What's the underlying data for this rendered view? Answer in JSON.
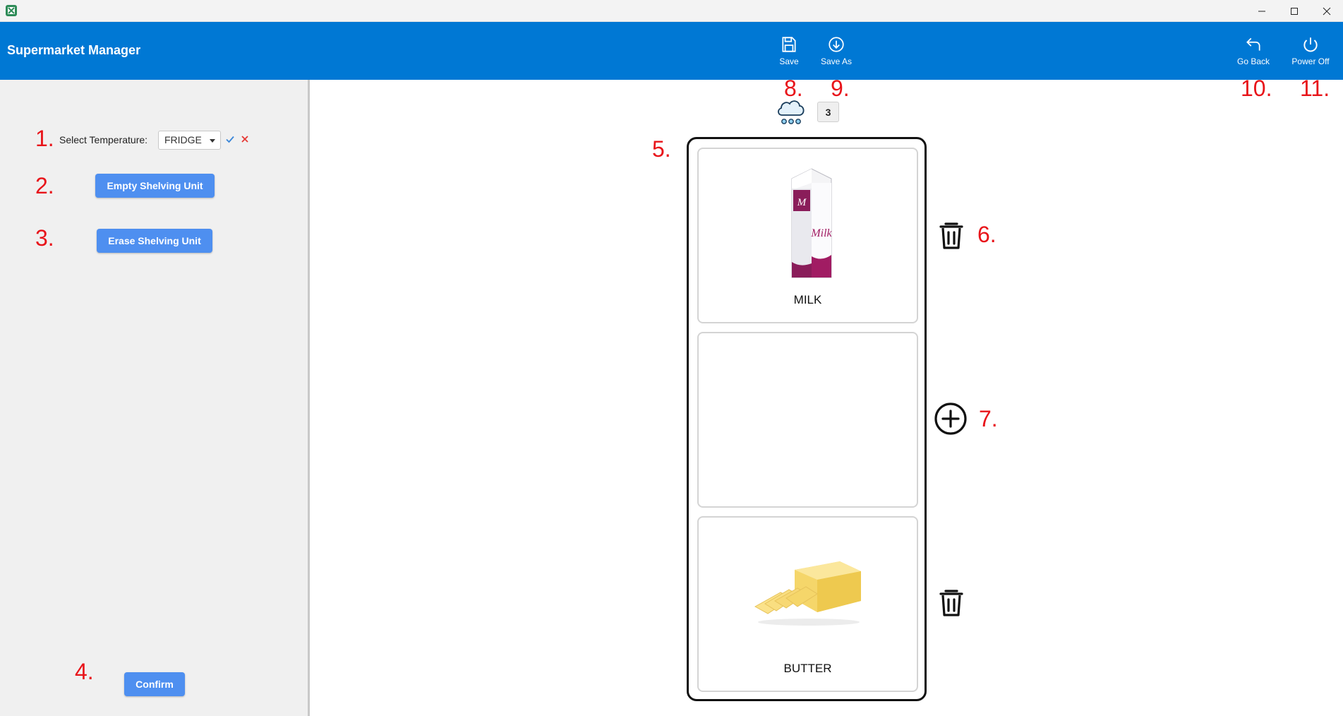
{
  "window": {
    "title": ""
  },
  "header": {
    "title": "Supermarket Manager",
    "save_label": "Save",
    "save_as_label": "Save As",
    "go_back_label": "Go Back",
    "power_off_label": "Power Off"
  },
  "left_panel": {
    "temperature_label": "Select Temperature:",
    "temperature_value": "FRIDGE",
    "empty_button": "Empty Shelving Unit",
    "erase_button": "Erase Shelving Unit",
    "confirm_button": "Confirm"
  },
  "main": {
    "temperature_icon": "snow-cloud-icon",
    "shelf_count": "3",
    "shelves": [
      {
        "name": "MILK",
        "image": "milk-carton",
        "action_icon": "trash-icon"
      },
      {
        "name": "",
        "image": "",
        "action_icon": "plus-circle-icon"
      },
      {
        "name": "BUTTER",
        "image": "butter-block",
        "action_icon": "trash-icon"
      }
    ]
  },
  "annotations": {
    "n1": "1.",
    "n2": "2.",
    "n3": "3.",
    "n4": "4.",
    "n5": "5.",
    "n6": "6.",
    "n7": "7.",
    "n8": "8.",
    "n9": "9.",
    "n10": "10.",
    "n11": "11."
  },
  "colors": {
    "header_bg": "#0078d4",
    "button_bg": "#4e8ff0",
    "annotation": "#e8141a",
    "left_panel_bg": "#f0f0f0"
  }
}
